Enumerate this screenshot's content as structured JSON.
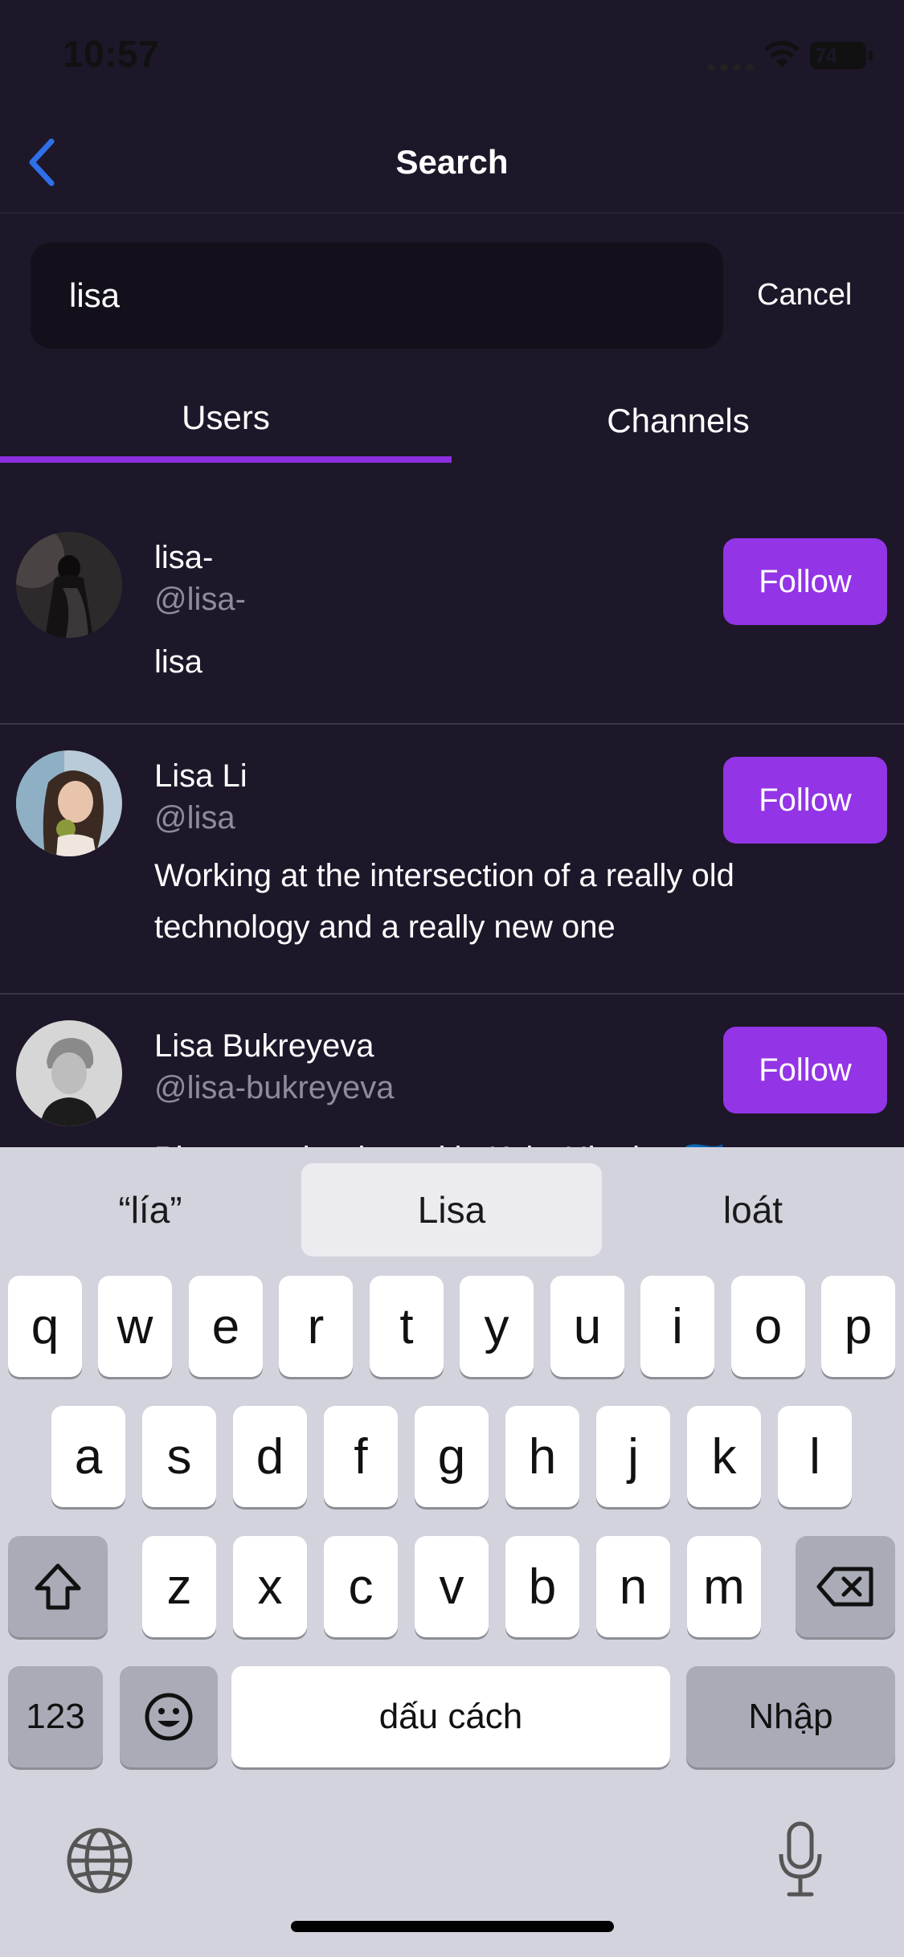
{
  "status_bar": {
    "time": "10:57",
    "battery": "74"
  },
  "nav": {
    "title": "Search"
  },
  "search": {
    "value": "lisa",
    "placeholder": "",
    "cancel_label": "Cancel"
  },
  "tabs": [
    {
      "label": "Users",
      "active": true
    },
    {
      "label": "Channels",
      "active": false
    }
  ],
  "results": [
    {
      "display_name": "lisa-",
      "handle": "@lisa-",
      "bio": "lisa",
      "follow_label": "Follow"
    },
    {
      "display_name": "Lisa Li",
      "handle": "@lisa",
      "bio": "Working at the intersection of a really old technology and a really new one",
      "follow_label": "Follow"
    },
    {
      "display_name": "Lisa Bukreyeva",
      "handle": "@lisa-bukreyeva",
      "bio": "Photographer based in Kyiv, Ukraine 🇺🇦",
      "follow_label": "Follow"
    }
  ],
  "keyboard": {
    "suggestions": [
      "“lía”",
      "Lisa",
      "loát"
    ],
    "selected_suggestion": 1,
    "row1": [
      "q",
      "w",
      "e",
      "r",
      "t",
      "y",
      "u",
      "i",
      "o",
      "p"
    ],
    "row2": [
      "a",
      "s",
      "d",
      "f",
      "g",
      "h",
      "j",
      "k",
      "l"
    ],
    "row3": [
      "z",
      "x",
      "c",
      "v",
      "b",
      "n",
      "m"
    ],
    "numbers_label": "123",
    "space_label": "dấu cách",
    "return_label": "Nhập"
  },
  "colors": {
    "background": "#1d1729",
    "accent": "#9334e6",
    "tab_indicator": "#8c2fe0",
    "back_arrow": "#2f6fea",
    "search_bg": "#13101b",
    "keyboard_bg": "#d2d3dc"
  },
  "icons": [
    "back-chevron-icon",
    "wifi-icon",
    "battery-icon",
    "shift-icon",
    "backspace-icon",
    "emoji-icon",
    "globe-icon",
    "microphone-icon"
  ]
}
